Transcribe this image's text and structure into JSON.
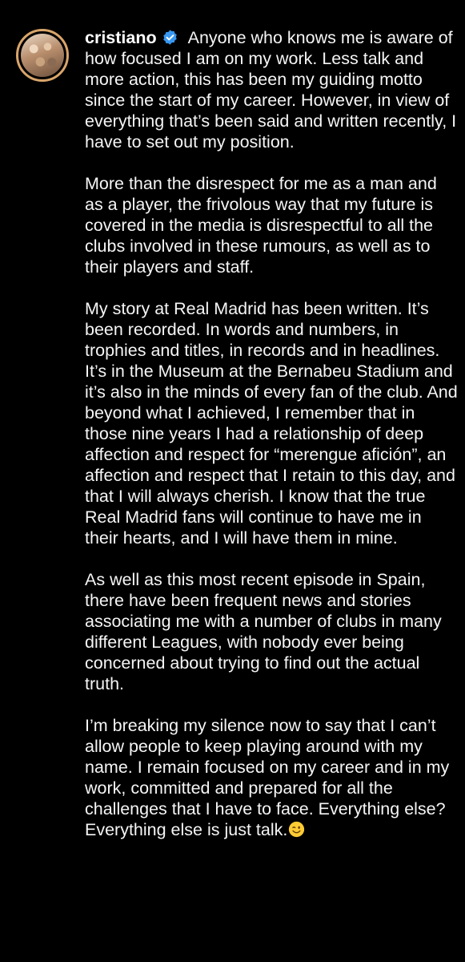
{
  "post": {
    "username": "cristiano",
    "verified_color": "#3897f0",
    "avatar_ring_color": "#d9a56a",
    "paragraphs": [
      "Anyone who knows me is aware of how focused I am on my work. Less talk and more action, this has been my guiding motto since the start of my career. However, in view of everything that’s been said and written recently, I have to set out my position.",
      "More than the disrespect for me as a man and as a player, the frivolous way that my future is covered in the media is disrespectful to all the clubs involved in these rumours, as well as to their players and staff.",
      "My story at Real Madrid has been written. It’s been recorded. In words and numbers, in trophies and titles, in records and in headlines. It’s in the Museum at the Bernabeu Stadium and it’s also in the minds of every fan of the club. And beyond what I achieved, I remember that in those nine years I had a relationship of deep affection and respect for “merengue afición”, an affection and respect that I retain to this day, and that I will always cherish. I know that the true Real Madrid fans will continue to have me in their hearts, and I will have them in mine.",
      "As well as this most recent episode in Spain, there have been frequent news and stories associating me with a number of clubs in many different Leagues, with nobody ever being concerned about trying to find out the actual truth.",
      "I’m breaking my silence now to say that I can’t allow people to keep playing around with my name. I remain focused on my career and in my work, committed and prepared for all the challenges that I have to face. Everything else? Everything else is just talk."
    ],
    "closing_emoji": "winking-face-emoji"
  }
}
